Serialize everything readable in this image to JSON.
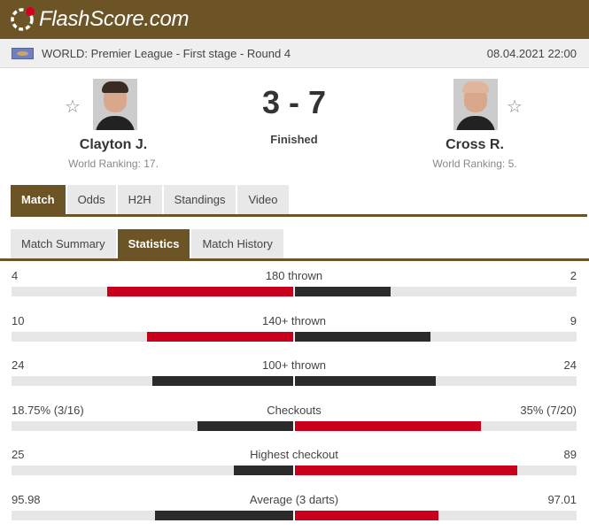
{
  "header": {
    "logo_text": "FlashScore.com"
  },
  "league": {
    "name": "WORLD: Premier League - First stage - Round 4",
    "datetime": "08.04.2021 22:00"
  },
  "match": {
    "home": {
      "name": "Clayton J.",
      "ranking": "World Ranking: 17."
    },
    "away": {
      "name": "Cross R.",
      "ranking": "World Ranking: 5."
    },
    "score": "3 - 7",
    "status": "Finished",
    "favorite_icon": "☆"
  },
  "main_tabs": [
    "Match",
    "Odds",
    "H2H",
    "Standings",
    "Video"
  ],
  "sub_tabs": [
    "Match Summary",
    "Statistics",
    "Match History"
  ],
  "colors": {
    "brand": "#6d5426",
    "winner_bar": "#c8001c",
    "loser_bar": "#2b2b2b",
    "track": "#e6e6e6"
  },
  "stats": [
    {
      "label": "180 thrown",
      "home": "4",
      "away": "2",
      "home_share": 0.66,
      "away_share": 0.34,
      "leader": "home"
    },
    {
      "label": "140+ thrown",
      "home": "10",
      "away": "9",
      "home_share": 0.52,
      "away_share": 0.48,
      "leader": "home"
    },
    {
      "label": "100+ thrown",
      "home": "24",
      "away": "24",
      "home_share": 0.5,
      "away_share": 0.5,
      "leader": "none"
    },
    {
      "label": "Checkouts",
      "home": "18.75% (3/16)",
      "away": "35% (7/20)",
      "home_share": 0.34,
      "away_share": 0.66,
      "leader": "away"
    },
    {
      "label": "Highest checkout",
      "home": "25",
      "away": "89",
      "home_share": 0.21,
      "away_share": 0.79,
      "leader": "away"
    },
    {
      "label": "Average (3 darts)",
      "home": "95.98",
      "away": "97.01",
      "home_share": 0.49,
      "away_share": 0.51,
      "leader": "away"
    }
  ]
}
